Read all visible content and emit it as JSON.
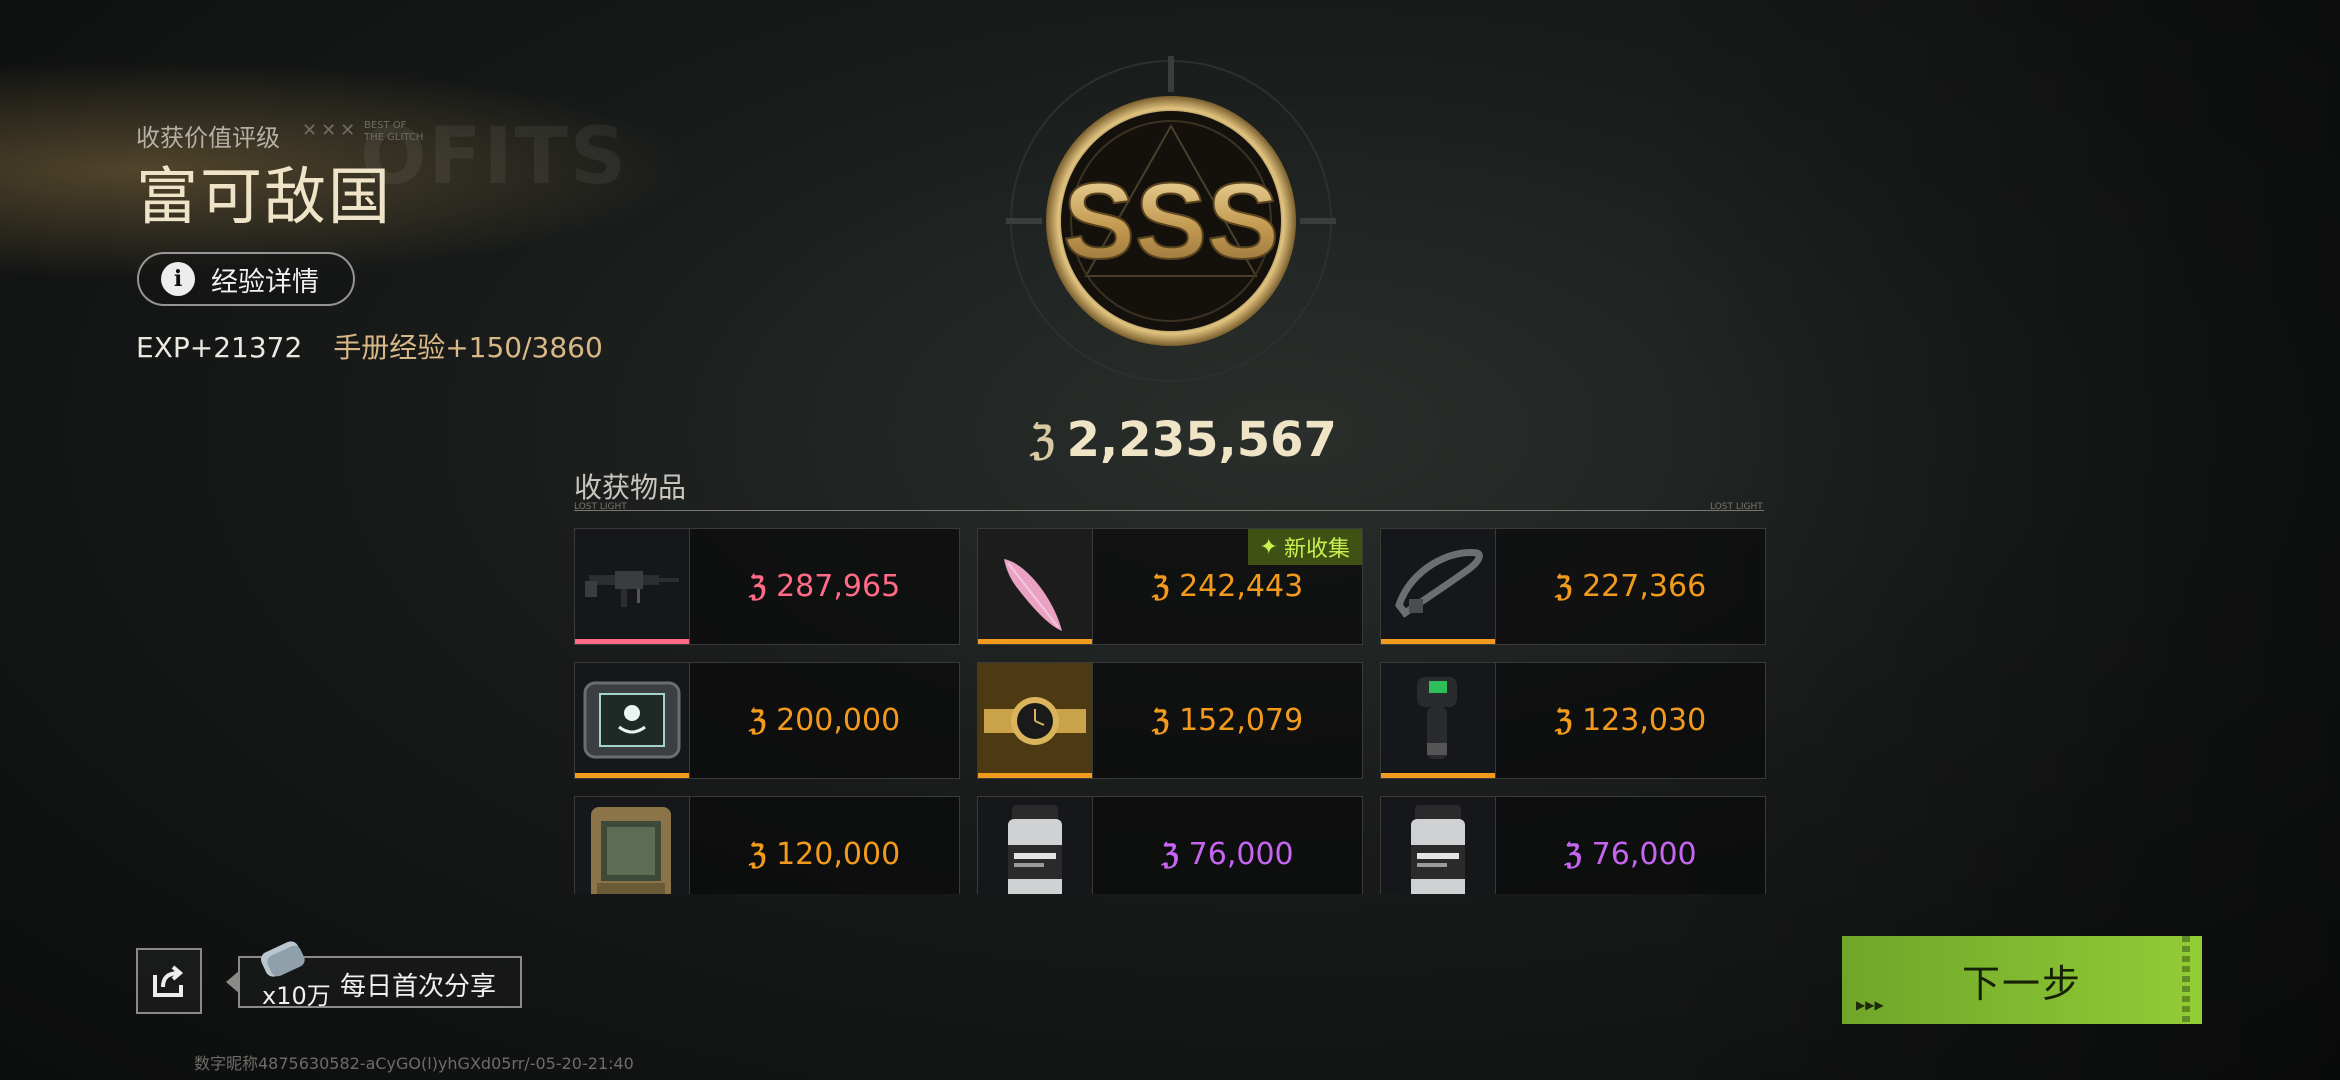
{
  "header": {
    "rating_label": "收获价值评级",
    "rating_title": "富可敌国",
    "exp_button_label": "经验详情",
    "exp_value": "EXP+21372",
    "manual_exp": "手册经验+150/3860"
  },
  "emblem": {
    "grade": "SSS"
  },
  "total_value": "2,235,567",
  "items_section": {
    "title": "收获物品"
  },
  "items": [
    {
      "value": "287,965",
      "rarity_color": "#ff6b86",
      "icon": "machine-gun-icon",
      "new_badge": ""
    },
    {
      "value": "242,443",
      "rarity_color": "#f29a1e",
      "icon": "pink-feather-icon",
      "new_badge": "新收集"
    },
    {
      "value": "227,366",
      "rarity_color": "#f29a1e",
      "icon": "cable-tie-icon",
      "new_badge": ""
    },
    {
      "value": "200,000",
      "rarity_color": "#f29a1e",
      "icon": "tablet-device-icon",
      "new_badge": ""
    },
    {
      "value": "152,079",
      "rarity_color": "#f29a1e",
      "icon": "gold-watch-icon",
      "new_badge": ""
    },
    {
      "value": "123,030",
      "rarity_color": "#f29a1e",
      "icon": "thermometer-gun-icon",
      "new_badge": ""
    },
    {
      "value": "120,000",
      "rarity_color": "#f29a1e",
      "icon": "camo-device-icon",
      "new_badge": ""
    },
    {
      "value": "76,000",
      "rarity_color": "#c565f0",
      "icon": "canister-icon",
      "new_badge": ""
    },
    {
      "value": "76,000",
      "rarity_color": "#c565f0",
      "icon": "canister-icon",
      "new_badge": ""
    }
  ],
  "share": {
    "multiplier": "x10万",
    "label": "每日首次分享"
  },
  "next_button": {
    "label": "下一步"
  },
  "watermark": "数字昵称4875630582-aCyGO(l)yhGXd05rr/-05-20-21:40",
  "colors": {
    "accent_gold": "#d9c9a2",
    "next_green": "#8cc63a",
    "pink": "#ff6b86",
    "orange": "#f29a1e",
    "purple": "#c565f0"
  }
}
